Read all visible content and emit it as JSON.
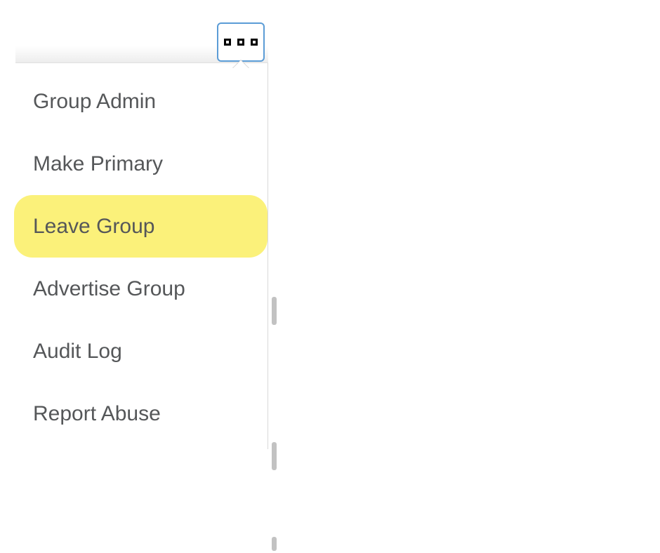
{
  "menu": {
    "items": [
      {
        "label": "Group Admin",
        "highlighted": false
      },
      {
        "label": "Make Primary",
        "highlighted": false
      },
      {
        "label": "Leave Group",
        "highlighted": true
      },
      {
        "label": "Advertise Group",
        "highlighted": false
      },
      {
        "label": "Audit Log",
        "highlighted": false
      },
      {
        "label": "Report Abuse",
        "highlighted": false
      }
    ]
  }
}
